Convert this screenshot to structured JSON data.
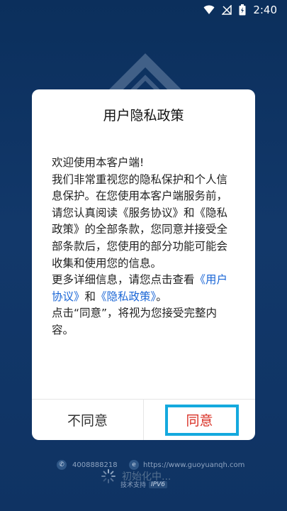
{
  "status_bar": {
    "time": "2:40",
    "icons": [
      "wifi-icon",
      "no-signal-icon",
      "battery-charging-icon"
    ]
  },
  "dialog": {
    "title": "用户隐私政策",
    "welcome": "欢迎使用本客户端!",
    "paragraph1": "我们非常重视您的隐私保护和个人信息保护。在您使用本客户端服务前，请您认真阅读《服务协议》和《隐私政策》的全部条款，您同意并接受全部条款后，您使用的部分功能可能会收集和使用您的信息。",
    "paragraph2_prefix": "更多详细信息，请您点击查看",
    "link_user_agreement": "《用户协议》",
    "and": "和",
    "link_privacy_policy": "《隐私政策》",
    "paragraph2_suffix": "。",
    "paragraph3": "点击“同意”，将视为您接受完整内容。",
    "disagree_label": "不同意",
    "agree_label": "同意"
  },
  "footer": {
    "phone": "4008888218",
    "website": "https://www.guoyuanqh.com",
    "loading_text": "初始化中...",
    "support_text": "技术支持",
    "ipv6_badge": "IPV6"
  },
  "colors": {
    "background": "#0f3363",
    "link": "#1a66d6",
    "agree": "#d93025",
    "highlight": "#14a9de"
  }
}
